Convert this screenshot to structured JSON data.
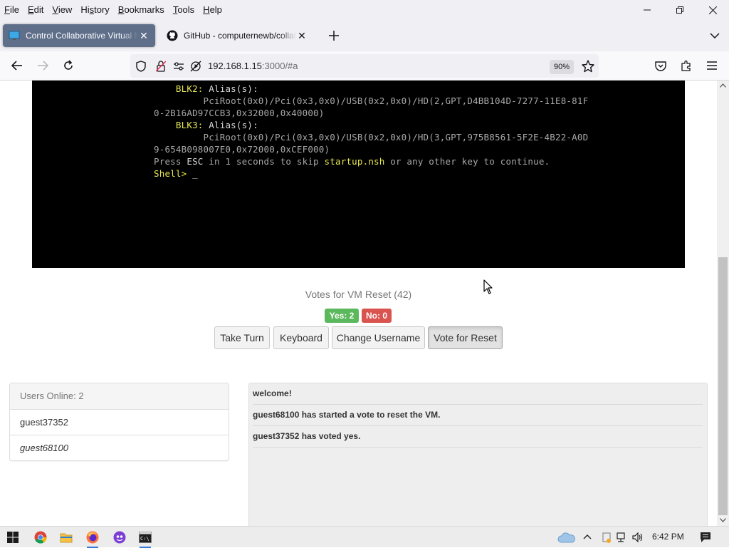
{
  "menubar": {
    "items": [
      {
        "label": "File",
        "key": "F"
      },
      {
        "label": "Edit",
        "key": "E"
      },
      {
        "label": "View",
        "key": "V"
      },
      {
        "label": "History",
        "key": "s"
      },
      {
        "label": "Bookmarks",
        "key": "B"
      },
      {
        "label": "Tools",
        "key": "T"
      },
      {
        "label": "Help",
        "key": "H"
      }
    ]
  },
  "tabs": [
    {
      "title": "Control Collaborative Virtual Machine",
      "active": true,
      "icon": "monitor-icon"
    },
    {
      "title": "GitHub - computernewb/collab-vm",
      "active": false,
      "icon": "github-icon"
    }
  ],
  "navbar": {
    "url_host": "192.168.1.15",
    "url_rest": ":3000/#a",
    "zoom": "90%"
  },
  "terminal": {
    "lines": [
      [
        {
          "t": "    BLK2: ",
          "c": "y"
        },
        {
          "t": "Alias(s):",
          "c": "w"
        }
      ],
      [
        {
          "t": "         PciRoot(0x0)/Pci(0x3,0x0)/USB(0x2,0x0)/HD(2,GPT,D4BB104D-7277-11E8-81F",
          "c": ""
        }
      ],
      [
        {
          "t": "0-2B16AD97CCB3,0x32000,0x40000)",
          "c": ""
        }
      ],
      [
        {
          "t": "    BLK3: ",
          "c": "y"
        },
        {
          "t": "Alias(s):",
          "c": "w"
        }
      ],
      [
        {
          "t": "         PciRoot(0x0)/Pci(0x3,0x0)/USB(0x2,0x0)/HD(3,GPT,975B8561-5F2E-4B22-A0D",
          "c": ""
        }
      ],
      [
        {
          "t": "9-654B098007E0,0x72000,0xCEF000)",
          "c": ""
        }
      ],
      [
        {
          "t": "Press ",
          "c": ""
        },
        {
          "t": "ESC",
          "c": "w"
        },
        {
          "t": " in 1 seconds to skip ",
          "c": ""
        },
        {
          "t": "startup.nsh",
          "c": "y"
        },
        {
          "t": " or any other key to continue.",
          "c": ""
        }
      ],
      [
        {
          "t": "Shell> ",
          "c": "y"
        },
        {
          "t": "_",
          "c": "w"
        }
      ]
    ]
  },
  "vote": {
    "title": "Votes for VM Reset (42)",
    "yes": "Yes: 2",
    "no": "No: 0"
  },
  "buttons": {
    "take_turn": "Take Turn",
    "keyboard": "Keyboard",
    "change_username": "Change Username",
    "vote_reset": "Vote for Reset"
  },
  "users": {
    "header": "Users Online: 2",
    "list": [
      "guest37352",
      "guest68100"
    ]
  },
  "chat": {
    "messages": [
      "welcome!",
      "guest68100 has started a vote to reset the VM.",
      "guest37352 has voted yes."
    ]
  },
  "taskbar": {
    "time": "6:42 PM"
  },
  "colors": {
    "yes_badge": "#5cb85c",
    "no_badge": "#d9534f",
    "active_tab": "#5f6f8a",
    "terminal_bg": "#000000",
    "terminal_highlight": "#e8e850"
  }
}
